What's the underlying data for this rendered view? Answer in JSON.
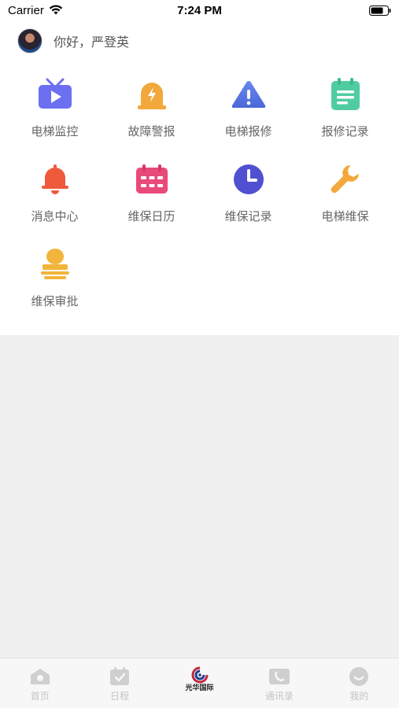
{
  "status_bar": {
    "carrier": "Carrier",
    "time": "7:24 PM"
  },
  "greeting": {
    "text": "你好，严登英"
  },
  "menu": {
    "items": [
      {
        "label": "电梯监控",
        "icon": "tv-monitor-icon",
        "color": "#6b6ff0"
      },
      {
        "label": "故障警报",
        "icon": "alarm-light-icon",
        "color": "#f2a83a"
      },
      {
        "label": "电梯报修",
        "icon": "warning-triangle-icon",
        "color": "#5b7ce8"
      },
      {
        "label": "报修记录",
        "icon": "clipboard-list-icon",
        "color": "#4fcca0"
      },
      {
        "label": "消息中心",
        "icon": "bell-icon",
        "color": "#ef5a3c"
      },
      {
        "label": "维保日历",
        "icon": "calendar-icon",
        "color": "#e84a7a"
      },
      {
        "label": "维保记录",
        "icon": "clock-icon",
        "color": "#5050d0"
      },
      {
        "label": "电梯维保",
        "icon": "wrench-icon",
        "color": "#f2a83a"
      },
      {
        "label": "维保审批",
        "icon": "approval-stamp-icon",
        "color": "#f2b43a"
      }
    ]
  },
  "tab_bar": {
    "tabs": [
      {
        "label": "首页",
        "icon": "home-icon"
      },
      {
        "label": "日程",
        "icon": "schedule-icon"
      },
      {
        "label": "光华国际",
        "icon": "brand-logo-icon"
      },
      {
        "label": "通讯录",
        "icon": "contacts-icon"
      },
      {
        "label": "我的",
        "icon": "profile-icon"
      }
    ]
  }
}
